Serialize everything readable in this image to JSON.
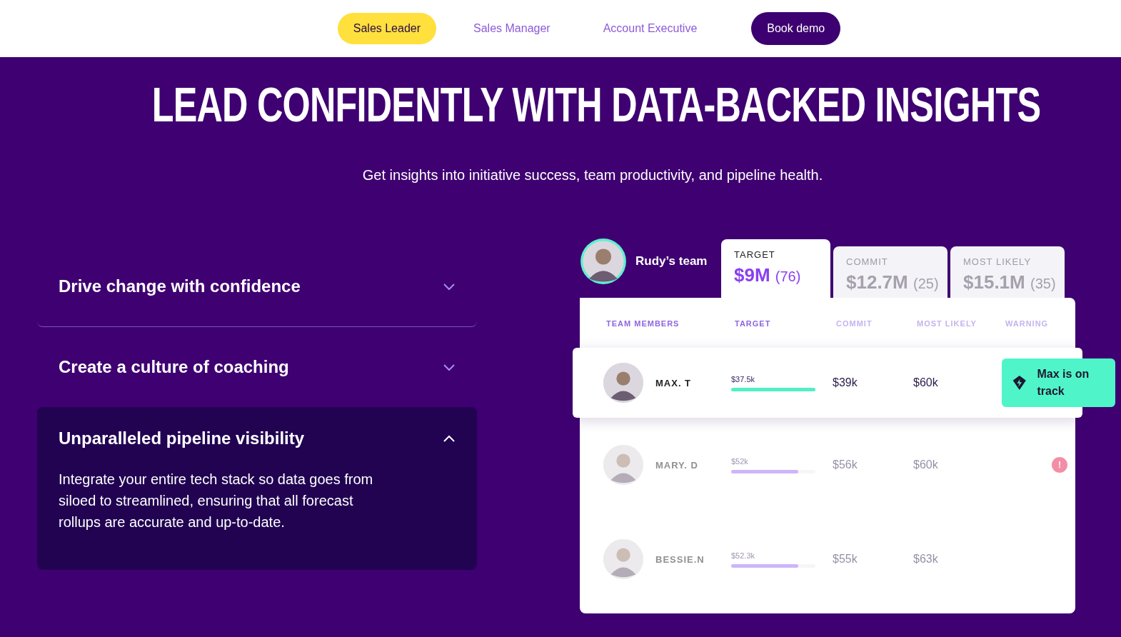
{
  "nav": {
    "items": [
      {
        "label": "Sales Leader",
        "selected": true
      },
      {
        "label": "Sales Manager",
        "selected": false
      },
      {
        "label": "Account Executive",
        "selected": false
      }
    ],
    "cta": "Book demo"
  },
  "hero": {
    "title": "LEAD CONFIDENTLY WITH DATA-BACKED INSIGHTS",
    "subtitle": "Get insights into initiative success, team productivity, and pipeline health."
  },
  "accordion": [
    {
      "title": "Drive change with confidence",
      "expanded": false
    },
    {
      "title": "Create a culture of coaching",
      "expanded": false
    },
    {
      "title": "Unparalleled pipeline visibility",
      "expanded": true,
      "body": "Integrate your entire tech stack so data goes from siloed to streamlined, ensuring that all forecast rollups are accurate and up-to-date."
    }
  ],
  "dashboard": {
    "team": "Rudy’s team",
    "tabs": [
      {
        "label": "TARGET",
        "value": "$9M",
        "count": "(76)",
        "selected": true
      },
      {
        "label": "COMMIT",
        "value": "$12.7M",
        "count": "(25)",
        "selected": false
      },
      {
        "label": "MOST LIKELY",
        "value": "$15.1M",
        "count": "(35)",
        "selected": false
      }
    ],
    "columns": [
      "TEAM MEMBERS",
      "TARGET",
      "COMMIT",
      "MOST LIKELY",
      "WARNING"
    ],
    "rows": [
      {
        "name": "MAX. T",
        "target": "$37.5k",
        "level": 1,
        "commit": "$39k",
        "likely": "$60k",
        "highlighted": true,
        "warning": {
          "kind": "badge",
          "text": "Max is on track"
        }
      },
      {
        "name": "MARY. D",
        "target": "$52k",
        "level": 0.8,
        "commit": "$56k",
        "likely": "$60k",
        "highlighted": false,
        "warning": {
          "kind": "alert",
          "text": "!"
        }
      },
      {
        "name": "BESSIE.N",
        "target": "$52.3k",
        "level": 0.8,
        "commit": "$55k",
        "likely": "$63k",
        "highlighted": false
      }
    ]
  }
}
